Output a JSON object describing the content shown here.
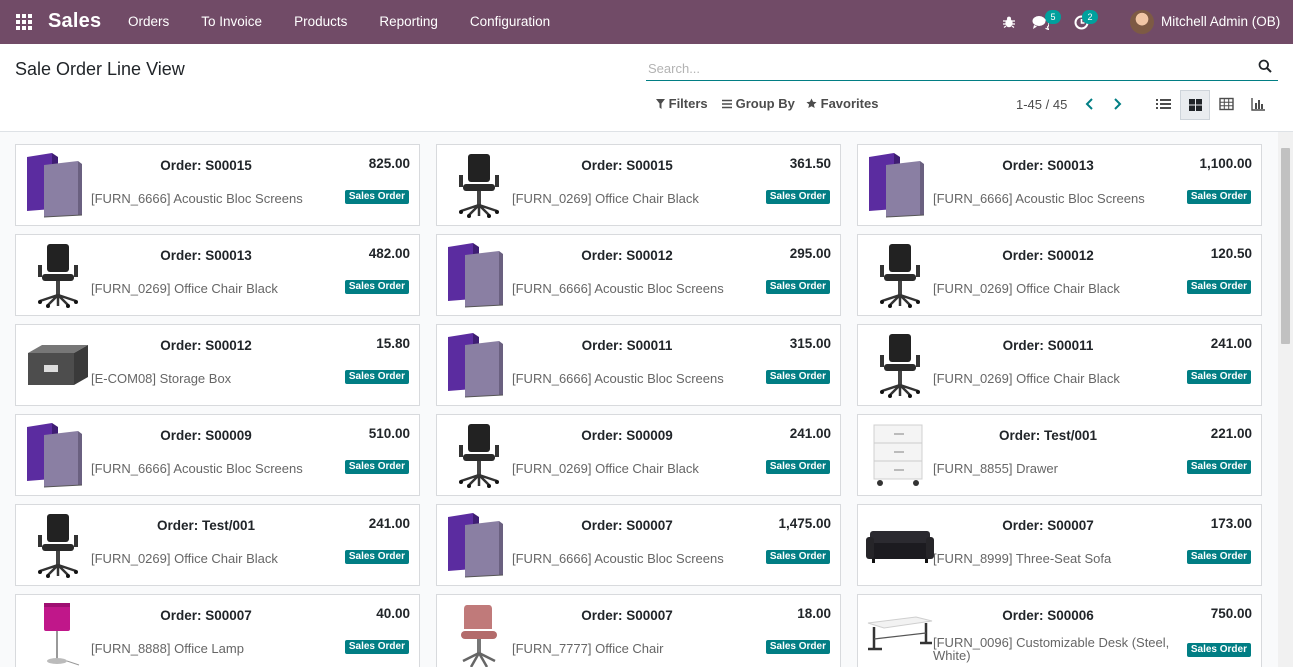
{
  "navbar": {
    "brand": "Sales",
    "menu": [
      {
        "label": "Orders"
      },
      {
        "label": "To Invoice"
      },
      {
        "label": "Products"
      },
      {
        "label": "Reporting"
      },
      {
        "label": "Configuration"
      }
    ],
    "messages_count": "5",
    "activities_count": "2",
    "user_name": "Mitchell Admin (OB)"
  },
  "control_panel": {
    "title": "Sale Order Line View",
    "search_placeholder": "Search...",
    "filters_label": "Filters",
    "group_by_label": "Group By",
    "favorites_label": "Favorites",
    "pager": "1-45 / 45",
    "active_view": "kanban"
  },
  "cards": [
    {
      "order": "Order: S00015",
      "amount": "825.00",
      "product": "[FURN_6666] Acoustic Bloc Screens",
      "state": "Sales Order",
      "image": "screens"
    },
    {
      "order": "Order: S00015",
      "amount": "361.50",
      "product": "[FURN_0269] Office Chair Black",
      "state": "Sales Order",
      "image": "chair"
    },
    {
      "order": "Order: S00013",
      "amount": "1,100.00",
      "product": "[FURN_6666] Acoustic Bloc Screens",
      "state": "Sales Order",
      "image": "screens"
    },
    {
      "order": "Order: S00013",
      "amount": "482.00",
      "product": "[FURN_0269] Office Chair Black",
      "state": "Sales Order",
      "image": "chair"
    },
    {
      "order": "Order: S00012",
      "amount": "295.00",
      "product": "[FURN_6666] Acoustic Bloc Screens",
      "state": "Sales Order",
      "image": "screens"
    },
    {
      "order": "Order: S00012",
      "amount": "120.50",
      "product": "[FURN_0269] Office Chair Black",
      "state": "Sales Order",
      "image": "chair"
    },
    {
      "order": "Order: S00012",
      "amount": "15.80",
      "product": "[E-COM08] Storage Box",
      "state": "Sales Order",
      "image": "box"
    },
    {
      "order": "Order: S00011",
      "amount": "315.00",
      "product": "[FURN_6666] Acoustic Bloc Screens",
      "state": "Sales Order",
      "image": "screens"
    },
    {
      "order": "Order: S00011",
      "amount": "241.00",
      "product": "[FURN_0269] Office Chair Black",
      "state": "Sales Order",
      "image": "chair"
    },
    {
      "order": "Order: S00009",
      "amount": "510.00",
      "product": "[FURN_6666] Acoustic Bloc Screens",
      "state": "Sales Order",
      "image": "screens"
    },
    {
      "order": "Order: S00009",
      "amount": "241.00",
      "product": "[FURN_0269] Office Chair Black",
      "state": "Sales Order",
      "image": "chair"
    },
    {
      "order": "Order: Test/001",
      "amount": "221.00",
      "product": "[FURN_8855] Drawer",
      "state": "Sales Order",
      "image": "drawer"
    },
    {
      "order": "Order: Test/001",
      "amount": "241.00",
      "product": "[FURN_0269] Office Chair Black",
      "state": "Sales Order",
      "image": "chair"
    },
    {
      "order": "Order: S00007",
      "amount": "1,475.00",
      "product": "[FURN_6666] Acoustic Bloc Screens",
      "state": "Sales Order",
      "image": "screens"
    },
    {
      "order": "Order: S00007",
      "amount": "173.00",
      "product": "[FURN_8999] Three-Seat Sofa",
      "state": "Sales Order",
      "image": "sofa"
    },
    {
      "order": "Order: S00007",
      "amount": "40.00",
      "product": "[FURN_8888] Office Lamp",
      "state": "Sales Order",
      "image": "lamp"
    },
    {
      "order": "Order: S00007",
      "amount": "18.00",
      "product": "[FURN_7777] Office Chair",
      "state": "Sales Order",
      "image": "pinkchair"
    },
    {
      "order": "Order: S00006",
      "amount": "750.00",
      "product": "[FURN_0096] Customizable Desk (Steel, White)",
      "state": "Sales Order",
      "image": "desk"
    }
  ]
}
